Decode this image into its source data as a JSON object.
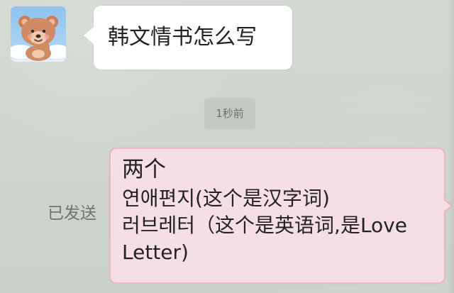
{
  "chat": {
    "incoming_message": {
      "text": "韩文情书怎么写"
    },
    "timestamp": {
      "text": "1秒前"
    },
    "sent_status": {
      "text": "已发送"
    },
    "outgoing_message": {
      "line_1": "两个",
      "line_2": "연애편지(这个是汉字词)",
      "line_3": "러브레터（这个是英语词,是Love",
      "line_4": "Letter)"
    }
  },
  "avatar": {
    "icon": "bear-avatar-icon"
  },
  "colors": {
    "background": "#cdd4cc",
    "incoming_bubble": "#ffffff",
    "outgoing_bubble": "#f6dfe4",
    "outgoing_border": "#e8b8c3",
    "timestamp_bg": "#c8cec7",
    "secondary_text": "#727272",
    "primary_text": "#222222"
  }
}
